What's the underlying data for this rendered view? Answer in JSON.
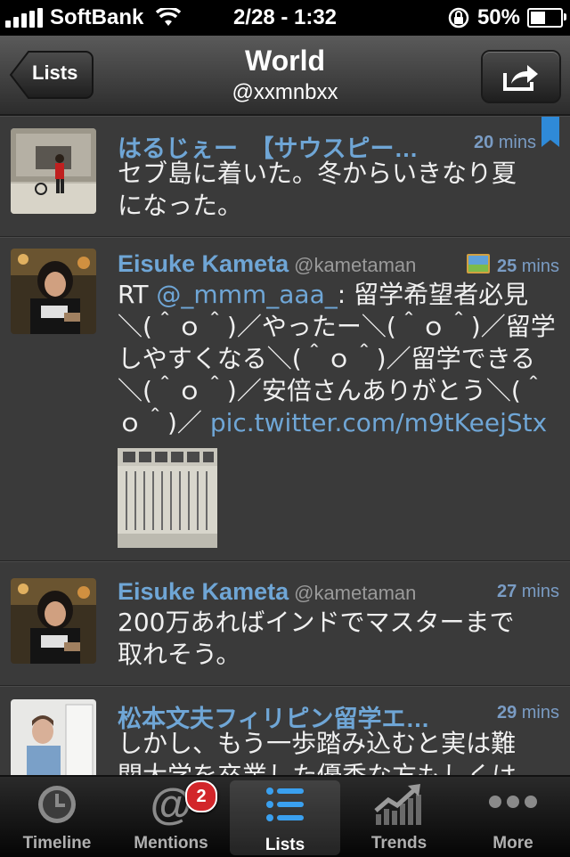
{
  "status": {
    "carrier": "SoftBank",
    "time": "2/28 - 1:32",
    "battery": "50%",
    "battery_level": 0.5
  },
  "nav": {
    "back_label": "Lists",
    "title": "World",
    "subtitle": "@xxmnbxx"
  },
  "tweets": [
    {
      "name": "はるじぇー　【サウスピー…",
      "handle": "",
      "time_num": "20",
      "time_unit": " mins",
      "lines": [
        "セブ島に着いた。冬からいきなり夏",
        "になった。"
      ]
    },
    {
      "name": "Eisuke Kameta",
      "handle": "@kametaman",
      "time_num": "25",
      "time_unit": " mins",
      "lines": [
        "RT ",
        "@_mmm_aaa_",
        ": 留学希望者必見",
        "＼(＾ｏ＾)／やったー＼(＾ｏ＾)／留学",
        "しやすくなる＼(＾ｏ＾)／留学できる",
        "＼(＾ｏ＾)／安倍さんありがとう＼(＾",
        "ｏ＾)／ ",
        "pic.twitter.com/m9tKeejStx"
      ]
    },
    {
      "name": "Eisuke Kameta",
      "handle": "@kametaman",
      "time_num": "27",
      "time_unit": " mins",
      "lines": [
        "200万あればインドでマスターまで",
        "取れそう。"
      ]
    },
    {
      "name": "松本文夫フィリピン留学エ…",
      "handle": "",
      "time_num": "29",
      "time_unit": " mins",
      "lines": [
        "しかし、もう一歩踏み込むと実は難",
        "関大学を卒業した優秀な方もしくは"
      ]
    }
  ],
  "tabs": [
    {
      "label": "Timeline"
    },
    {
      "label": "Mentions",
      "badge": "2"
    },
    {
      "label": "Lists"
    },
    {
      "label": "Trends"
    },
    {
      "label": "More"
    }
  ],
  "colors": {
    "link": "#6fa6d6",
    "background": "#3a3a3a",
    "badge": "#d2262a"
  }
}
